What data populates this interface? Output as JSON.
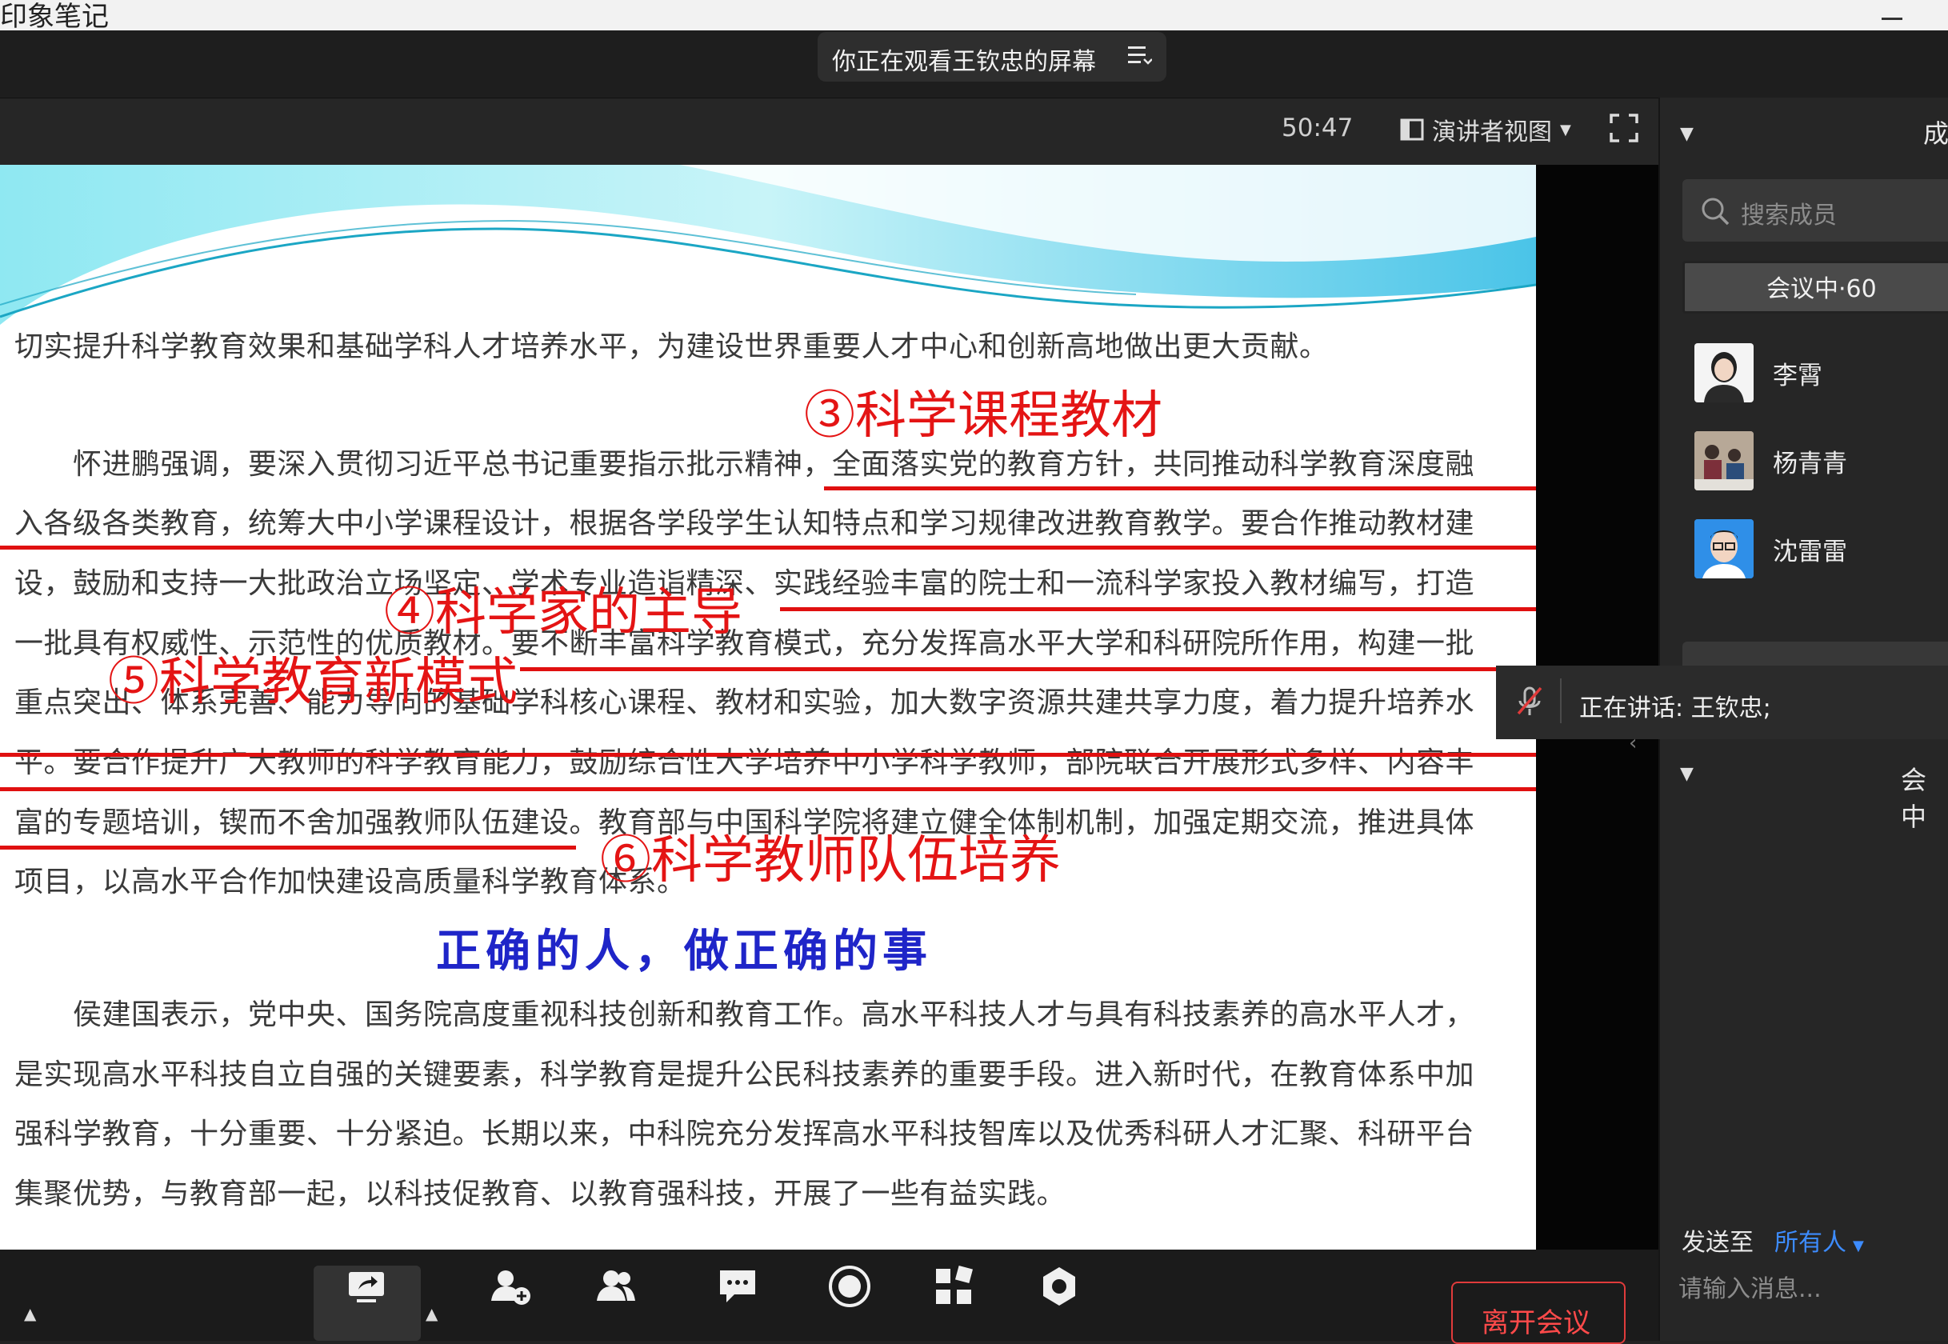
{
  "window": {
    "title": "印象笔记"
  },
  "banner": {
    "share_text": "你正在观看王钦忠的屏幕"
  },
  "toolbar": {
    "timer": "50:47",
    "view_mode": "演讲者视图"
  },
  "slide": {
    "lines": [
      "切实提升科学教育效果和基础学科人才培养水平，为建设世界重要人才中心和创新高地做出更大贡献。",
      "　　怀进鹏强调，要深入贯彻习近平总书记重要指示批示精神，全面落实党的教育方针，共同推动科学教育深度融",
      "入各级各类教育，统筹大中小学课程设计，根据各学段学生认知特点和学习规律改进教育教学。要合作推动教材建",
      "设，鼓励和支持一大批政治立场坚定、学术专业造诣精深、实践经验丰富的院士和一流科学家投入教材编写，打造",
      "一批具有权威性、示范性的优质教材。要不断丰富科学教育模式，充分发挥高水平大学和科研院所作用，构建一批",
      "重点突出、体系完善、能力导向的基础学科核心课程、教材和实验，加大数字资源共建共享力度，着力提升培养水",
      "平。要合作提升广大教师的科学教育能力，鼓励综合性大学培养中小学科学教师，部院联合开展形式多样、内容丰",
      "富的专题培训，锲而不舍加强教师队伍建设。教育部与中国科学院将建立健全体制机制，加强定期交流，推进具体",
      "项目，以高水平合作加快建设高质量科学教育体系。"
    ],
    "heading": "正确的人，做正确的事",
    "lines2": [
      "　　侯建国表示，党中央、国务院高度重视科技创新和教育工作。高水平科技人才与具有科技素养的高水平人才，",
      "是实现高水平科技自立自强的关键要素，科学教育是提升公民科技素养的重要手段。进入新时代，在教育体系中加",
      "强科学教育，十分重要、十分紧迫。长期以来，中科院充分发挥高水平科技智库以及优秀科研人才汇聚、科研平台",
      "集聚优势，与教育部一起，以科技促教育、以教育强科技，开展了一些有益实践。"
    ],
    "annotations": {
      "a3": "③科学课程教材",
      "a4": "④科学家的主导",
      "a5": "⑤科学教育新模式",
      "a6": "⑥科学教师队伍培养"
    },
    "annotation_color": "#e41414",
    "heading_color": "#1f25c8"
  },
  "panel": {
    "title": "成",
    "search_placeholder": "搜索成员",
    "tab_label": "会议中·60",
    "members": [
      {
        "name": "李霄"
      },
      {
        "name": "杨青青"
      },
      {
        "name": "沈雷雷"
      }
    ],
    "speaking": "正在讲话: 王钦忠;",
    "chat_title": "会中",
    "send_to_label": "发送至",
    "send_target": "所有人",
    "chat_placeholder": "请输入消息..."
  },
  "bottom": {
    "tools": [
      {
        "icon": "share-screen-icon"
      },
      {
        "icon": "invite-icon"
      },
      {
        "icon": "members-icon"
      },
      {
        "icon": "chat-icon"
      },
      {
        "icon": "record-icon"
      },
      {
        "icon": "apps-icon"
      },
      {
        "icon": "settings-icon"
      }
    ],
    "leave_label": "离开会议"
  }
}
